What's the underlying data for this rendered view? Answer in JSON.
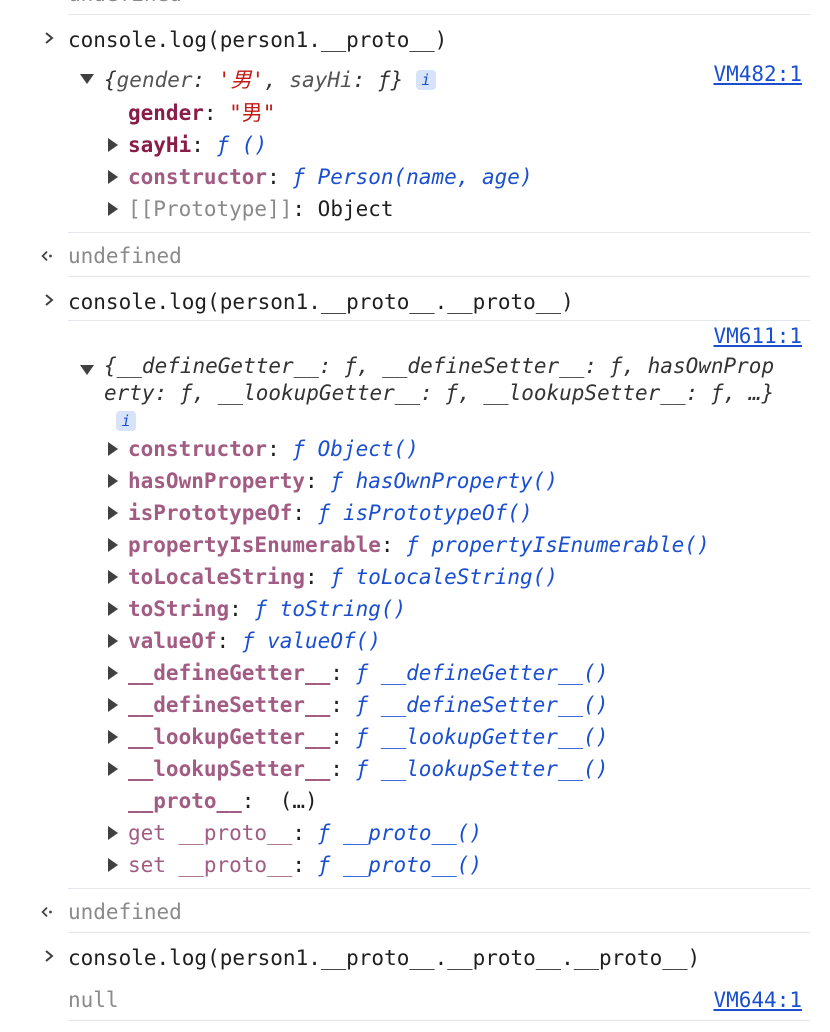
{
  "top_partial": "undefined",
  "blocks": [
    {
      "command": "console.log(person1.__proto__)",
      "source": "VM482:1",
      "summary": {
        "open": "{",
        "gender_key": "gender",
        "gender_val": "'男'",
        "sayhi_key": "sayHi",
        "close": "}"
      },
      "props": [
        {
          "key": "gender",
          "val": "\"男\""
        },
        {
          "key": "sayHi",
          "val": "ƒ ()"
        },
        {
          "key": "constructor",
          "val": "ƒ Person(name, age)"
        },
        {
          "key": "[[Prototype]]",
          "val": "Object"
        }
      ],
      "result": "undefined"
    },
    {
      "command": "console.log(person1.__proto__.__proto__)",
      "source": "VM611:1",
      "summary_line1": "{__defineGetter__: ƒ, __defineSetter__: ƒ, hasOwnProp",
      "summary_line2": "erty: ƒ, __lookupGetter__: ƒ, __lookupSetter__: ƒ, …}",
      "props": [
        {
          "key": "constructor",
          "val": "ƒ Object()"
        },
        {
          "key": "hasOwnProperty",
          "val": "ƒ hasOwnProperty()"
        },
        {
          "key": "isPrototypeOf",
          "val": "ƒ isPrototypeOf()"
        },
        {
          "key": "propertyIsEnumerable",
          "val": "ƒ propertyIsEnumerable()"
        },
        {
          "key": "toLocaleString",
          "val": "ƒ toLocaleString()"
        },
        {
          "key": "toString",
          "val": "ƒ toString()"
        },
        {
          "key": "valueOf",
          "val": "ƒ valueOf()"
        },
        {
          "key": "__defineGetter__",
          "val": "ƒ __defineGetter__()"
        },
        {
          "key": "__defineSetter__",
          "val": "ƒ __defineSetter__()"
        },
        {
          "key": "__lookupGetter__",
          "val": "ƒ __lookupGetter__()"
        },
        {
          "key": "__lookupSetter__",
          "val": "ƒ __lookupSetter__()"
        },
        {
          "key": "__proto__",
          "val": "(…)"
        },
        {
          "key": "get __proto__",
          "val": "ƒ __proto__()"
        },
        {
          "key": "set __proto__",
          "val": "ƒ __proto__()"
        }
      ],
      "result": "undefined"
    },
    {
      "command": "console.log(person1.__proto__.__proto__.__proto__)",
      "source": "VM644:1",
      "output": "null"
    }
  ],
  "info_badge": "i",
  "icons": {
    "prompt": "chevron-right-icon",
    "result": "return-arrow-icon",
    "expand": "triangle-icon"
  },
  "colors": {
    "link": "#1a4fd0",
    "key": "#7a2a5a",
    "string": "#c41a16",
    "muted": "#8a8a8a"
  }
}
